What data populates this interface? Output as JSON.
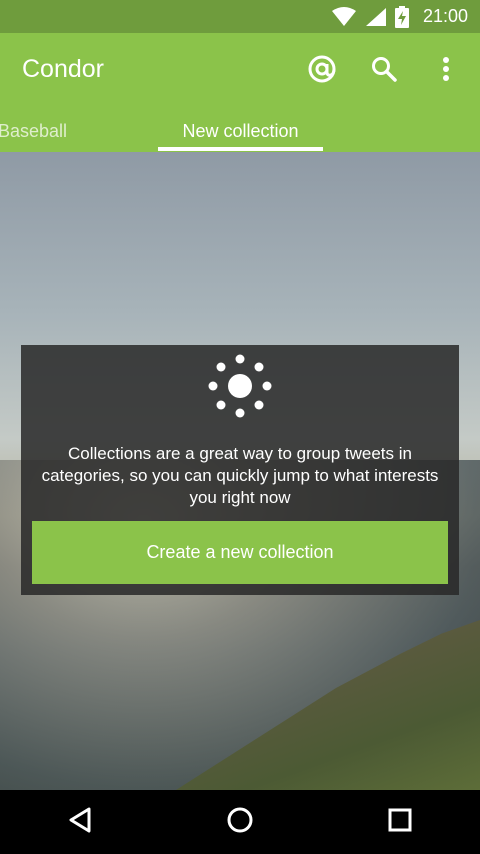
{
  "status_bar": {
    "time": "21:00",
    "icons": [
      "wifi-icon",
      "signal-icon",
      "battery-charging-icon"
    ]
  },
  "app_bar": {
    "title": "Condor",
    "actions": [
      "mentions-icon",
      "search-icon",
      "overflow-menu-icon"
    ]
  },
  "tabs": [
    {
      "label": "Baseball",
      "active": false
    },
    {
      "label": "New collection",
      "active": true
    }
  ],
  "collection_card": {
    "icon": "idea-bulb-icon",
    "message": "Collections are a great way to group tweets in categories, so you can quickly jump to what interests you right now",
    "button_label": "Create a new collection"
  },
  "nav_bar": {
    "buttons": [
      "back-icon",
      "home-icon",
      "recents-icon"
    ]
  },
  "colors": {
    "accent": "#8bc34a",
    "status_bar": "#6f9c3d",
    "card_background": "rgba(40,40,40,0.85)"
  }
}
